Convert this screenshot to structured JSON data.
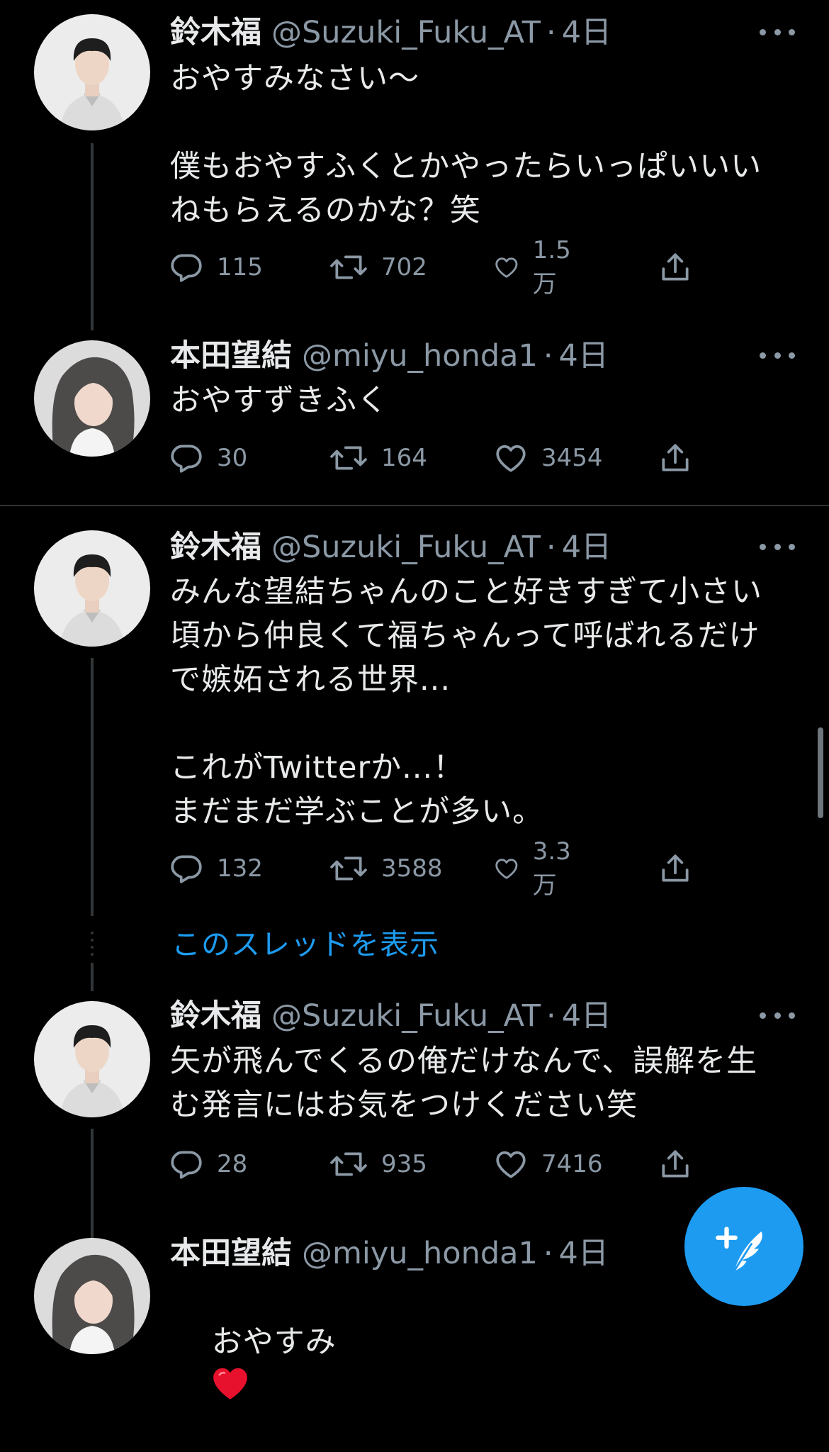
{
  "colors": {
    "background": "#000000",
    "text": "#e7e9ea",
    "secondary": "#8b98a5",
    "accent": "#1d9bf0",
    "heart": "#e8112d"
  },
  "tweets": [
    {
      "display_name": "鈴木福",
      "handle": "@Suzuki_Fuku_AT",
      "separator": "·",
      "time": "4日",
      "text": "おやすみなさい〜\n\n僕もおやすふくとかやったらいっぱいいい\nねもらえるのかな？笑",
      "replies": "115",
      "retweets": "702",
      "likes": "1.5万",
      "avatar_icon": "avatar-boy"
    },
    {
      "display_name": "本田望結",
      "handle": "@miyu_honda1",
      "separator": "·",
      "time": "4日",
      "text": "おやすずきふく",
      "replies": "30",
      "retweets": "164",
      "likes": "3454",
      "avatar_icon": "avatar-girl"
    },
    {
      "display_name": "鈴木福",
      "handle": "@Suzuki_Fuku_AT",
      "separator": "·",
      "time": "4日",
      "text": "みんな望結ちゃんのこと好きすぎて小さい\n頃から仲良くて福ちゃんって呼ばれるだけ\nで嫉妬される世界...\n\nこれがTwitterか...！\nまだまだ学ぶことが多い。",
      "replies": "132",
      "retweets": "3588",
      "likes": "3.3万",
      "avatar_icon": "avatar-boy"
    },
    {
      "display_name": "鈴木福",
      "handle": "@Suzuki_Fuku_AT",
      "separator": "·",
      "time": "4日",
      "text": "矢が飛んでくるの俺だけなんで、誤解を生\nむ発言にはお気をつけください笑",
      "replies": "28",
      "retweets": "935",
      "likes": "7416",
      "avatar_icon": "avatar-boy"
    },
    {
      "display_name": "本田望結",
      "handle": "@miyu_honda1",
      "separator": "·",
      "time": "4日",
      "text": "おやすみ",
      "emoji": "red-heart-icon",
      "avatar_icon": "avatar-girl"
    }
  ],
  "show_thread_label": "このスレッドを表示",
  "compose_button_icon": "compose-feather-plus-icon"
}
